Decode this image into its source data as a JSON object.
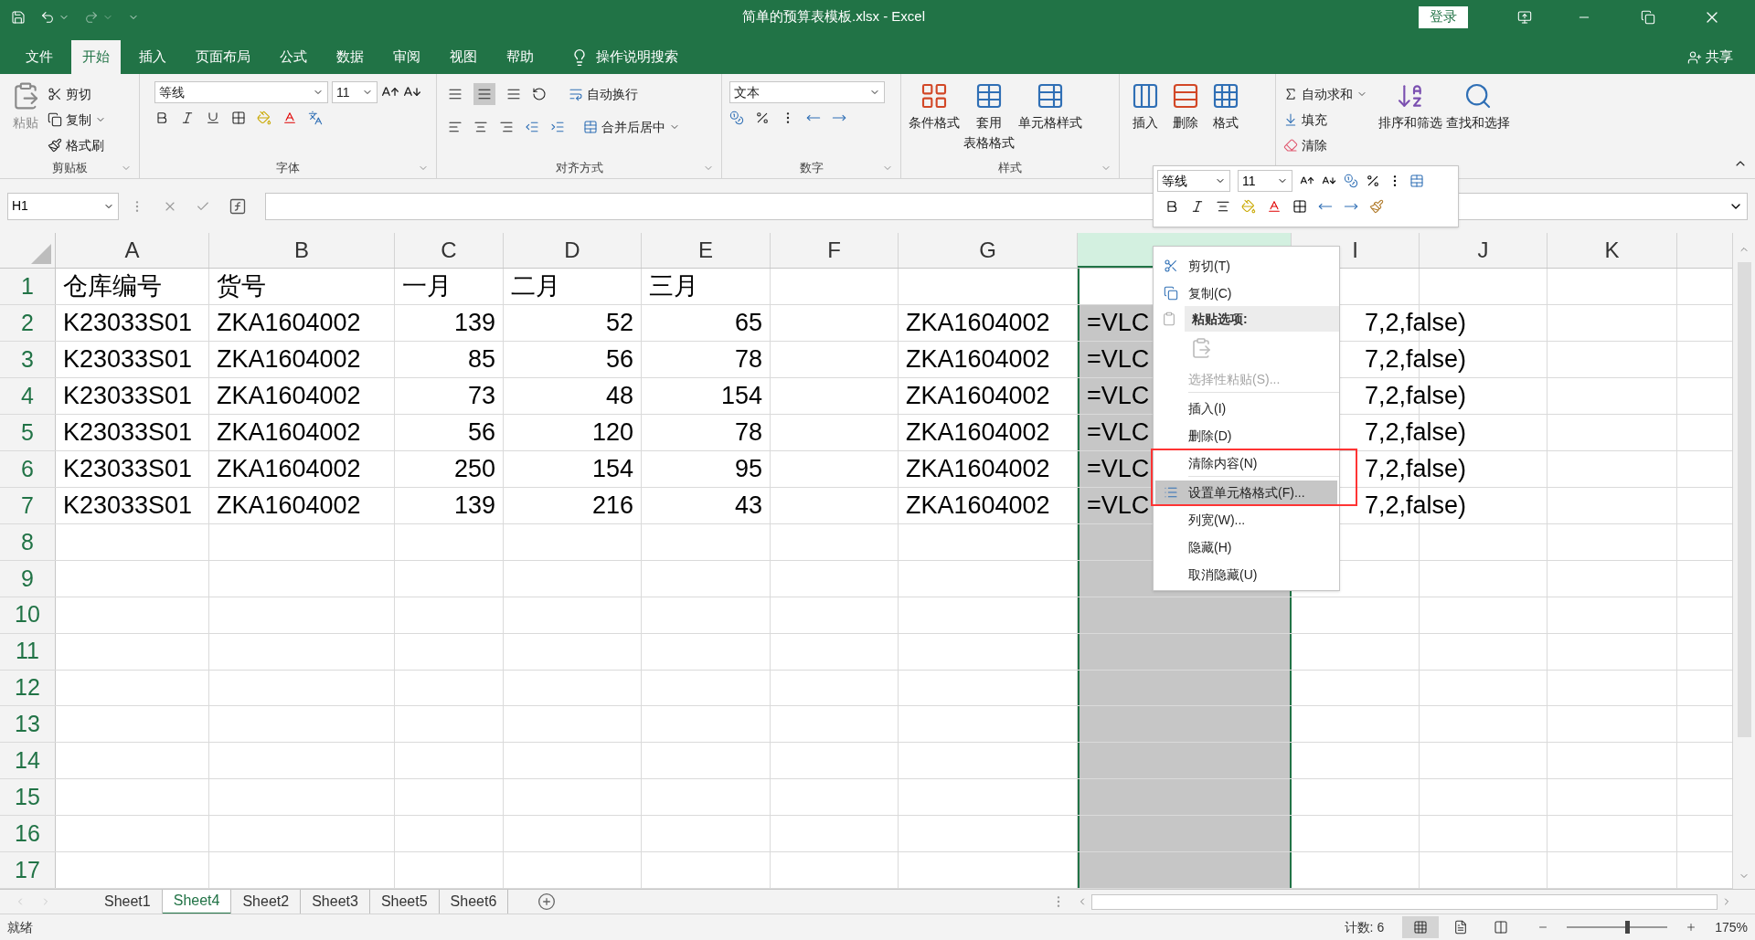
{
  "title_bar": {
    "title": "简单的预算表模板.xlsx  -  Excel",
    "sign_in": "登录"
  },
  "menu_tabs": [
    {
      "label": "文件",
      "selected": false
    },
    {
      "label": "开始",
      "selected": true
    },
    {
      "label": "插入",
      "selected": false
    },
    {
      "label": "页面布局",
      "selected": false
    },
    {
      "label": "公式",
      "selected": false
    },
    {
      "label": "数据",
      "selected": false
    },
    {
      "label": "审阅",
      "selected": false
    },
    {
      "label": "视图",
      "selected": false
    },
    {
      "label": "帮助",
      "selected": false
    }
  ],
  "tell_me": "操作说明搜索",
  "share": "共享",
  "clipboard": {
    "label": "剪贴板",
    "paste": "粘贴",
    "cut": "剪切",
    "copy": "复制",
    "format_painter": "格式刷"
  },
  "font": {
    "label": "字体",
    "font_name": "等线",
    "font_size": "11"
  },
  "alignment": {
    "label": "对齐方式",
    "wrap": "自动换行",
    "merge": "合并后居中"
  },
  "number": {
    "label": "数字",
    "format": "文本"
  },
  "styles": {
    "label": "样式",
    "conditional": "条件格式",
    "table_format_1": "套用",
    "table_format_2": "表格格式",
    "cell_styles": "单元格样式"
  },
  "cells": {
    "insert": "插入",
    "delete": "删除",
    "format": "格式"
  },
  "editing": {
    "autosum": "自动求和",
    "fill": "填充",
    "clear": "清除",
    "sort": "排序和筛选",
    "find": "查找和选择"
  },
  "mini_toolbar": {
    "font_name": "等线",
    "font_size": "11"
  },
  "name_box": "H1",
  "columns": [
    {
      "label": "A",
      "selected": false
    },
    {
      "label": "B",
      "selected": false
    },
    {
      "label": "C",
      "selected": false
    },
    {
      "label": "D",
      "selected": false
    },
    {
      "label": "E",
      "selected": false
    },
    {
      "label": "F",
      "selected": false
    },
    {
      "label": "G",
      "selected": false
    },
    {
      "selected": true
    },
    {
      "label": "I",
      "selected": false
    },
    {
      "label": "J",
      "selected": false
    },
    {
      "label": "K",
      "selected": false
    }
  ],
  "rows": [
    {
      "number": "1",
      "cells": [
        {
          "text": "仓库编号",
          "kind": "text"
        },
        {
          "text": "货号",
          "kind": "text"
        },
        {
          "text": "一月",
          "kind": "text"
        },
        {
          "text": "二月",
          "kind": "text"
        },
        {
          "text": "三月",
          "kind": "text"
        }
      ]
    },
    {
      "number": "2",
      "cells": [
        {
          "text": "K23033S01",
          "kind": "text"
        },
        {
          "text": "ZKA1604002",
          "kind": "text"
        },
        {
          "text": "139",
          "kind": "number"
        },
        {
          "text": "52",
          "kind": "number"
        },
        {
          "text": "65",
          "kind": "number"
        },
        null,
        {
          "text": "ZKA1604002",
          "kind": "text"
        },
        {
          "text": "=VLC",
          "kind": "text"
        },
        {
          "text": "7,2,false)",
          "kind": "text"
        }
      ]
    },
    {
      "number": "3",
      "cells": [
        {
          "text": "K23033S01",
          "kind": "text"
        },
        {
          "text": "ZKA1604002",
          "kind": "text"
        },
        {
          "text": "85",
          "kind": "number"
        },
        {
          "text": "56",
          "kind": "number"
        },
        {
          "text": "78",
          "kind": "number"
        },
        null,
        {
          "text": "ZKA1604002",
          "kind": "text"
        },
        {
          "text": "=VLC",
          "kind": "text"
        },
        {
          "text": "7,2,false)",
          "kind": "text"
        }
      ]
    },
    {
      "number": "4",
      "cells": [
        {
          "text": "K23033S01",
          "kind": "text"
        },
        {
          "text": "ZKA1604002",
          "kind": "text"
        },
        {
          "text": "73",
          "kind": "number"
        },
        {
          "text": "48",
          "kind": "number"
        },
        {
          "text": "154",
          "kind": "number"
        },
        null,
        {
          "text": "ZKA1604002",
          "kind": "text"
        },
        {
          "text": "=VLC",
          "kind": "text"
        },
        {
          "text": "7,2,false)",
          "kind": "text"
        }
      ]
    },
    {
      "number": "5",
      "cells": [
        {
          "text": "K23033S01",
          "kind": "text"
        },
        {
          "text": "ZKA1604002",
          "kind": "text"
        },
        {
          "text": "56",
          "kind": "number"
        },
        {
          "text": "120",
          "kind": "number"
        },
        {
          "text": "78",
          "kind": "number"
        },
        null,
        {
          "text": "ZKA1604002",
          "kind": "text"
        },
        {
          "text": "=VLC",
          "kind": "text"
        },
        {
          "text": "7,2,false)",
          "kind": "text"
        }
      ]
    },
    {
      "number": "6",
      "cells": [
        {
          "text": "K23033S01",
          "kind": "text"
        },
        {
          "text": "ZKA1604002",
          "kind": "text"
        },
        {
          "text": "250",
          "kind": "number"
        },
        {
          "text": "154",
          "kind": "number"
        },
        {
          "text": "95",
          "kind": "number"
        },
        null,
        {
          "text": "ZKA1604002",
          "kind": "text"
        },
        {
          "text": "=VLC",
          "kind": "text"
        },
        {
          "text": "7,2,false)",
          "kind": "text"
        }
      ]
    },
    {
      "number": "7",
      "cells": [
        {
          "text": "K23033S01",
          "kind": "text"
        },
        {
          "text": "ZKA1604002",
          "kind": "text"
        },
        {
          "text": "139",
          "kind": "number"
        },
        {
          "text": "216",
          "kind": "number"
        },
        {
          "text": "43",
          "kind": "number"
        },
        null,
        {
          "text": "ZKA1604002",
          "kind": "text"
        },
        {
          "text": "=VLC",
          "kind": "text"
        },
        {
          "text": "7,2,false)",
          "kind": "text"
        }
      ]
    },
    {
      "number": "8",
      "cells": []
    },
    {
      "number": "9",
      "cells": []
    },
    {
      "number": "10",
      "cells": []
    },
    {
      "number": "11",
      "cells": []
    },
    {
      "number": "12",
      "cells": []
    },
    {
      "number": "13",
      "cells": []
    },
    {
      "number": "14",
      "cells": []
    },
    {
      "number": "15",
      "cells": []
    },
    {
      "number": "16",
      "cells": []
    },
    {
      "number": "17",
      "cells": []
    }
  ],
  "context_menu": [
    {
      "kind": "item",
      "label": "剪切(T)",
      "disabled": false,
      "selected": false
    },
    {
      "kind": "item",
      "label": "复制(C)",
      "disabled": false,
      "selected": false
    },
    {
      "kind": "header",
      "label": "粘贴选项:"
    },
    {
      "kind": "paste_options"
    },
    {
      "kind": "item",
      "label": "选择性粘贴(S)...",
      "disabled": true,
      "selected": false
    },
    {
      "kind": "separator"
    },
    {
      "kind": "item",
      "label": "插入(I)",
      "disabled": false,
      "selected": false
    },
    {
      "kind": "item",
      "label": "删除(D)",
      "disabled": false,
      "selected": false
    },
    {
      "kind": "item",
      "label": "清除内容(N)",
      "disabled": false,
      "selected": false
    },
    {
      "kind": "separator"
    },
    {
      "kind": "item",
      "label": "设置单元格格式(F)...",
      "disabled": false,
      "selected": true
    },
    {
      "kind": "item",
      "label": "列宽(W)...",
      "disabled": false,
      "selected": false
    },
    {
      "kind": "item",
      "label": "隐藏(H)",
      "disabled": false,
      "selected": false
    },
    {
      "kind": "item",
      "label": "取消隐藏(U)",
      "disabled": false,
      "selected": false
    }
  ],
  "sheet_tabs": [
    {
      "label": "Sheet1",
      "selected": false
    },
    {
      "label": "Sheet4",
      "selected": true
    },
    {
      "label": "Sheet2",
      "selected": false
    },
    {
      "label": "Sheet3",
      "selected": false
    },
    {
      "label": "Sheet5",
      "selected": false
    },
    {
      "label": "Sheet6",
      "selected": false
    }
  ],
  "status_bar": {
    "ready": "就绪",
    "count": "计数: 6",
    "zoom": "175%",
    "zoom_slider": {
      "level": 0.6
    }
  }
}
